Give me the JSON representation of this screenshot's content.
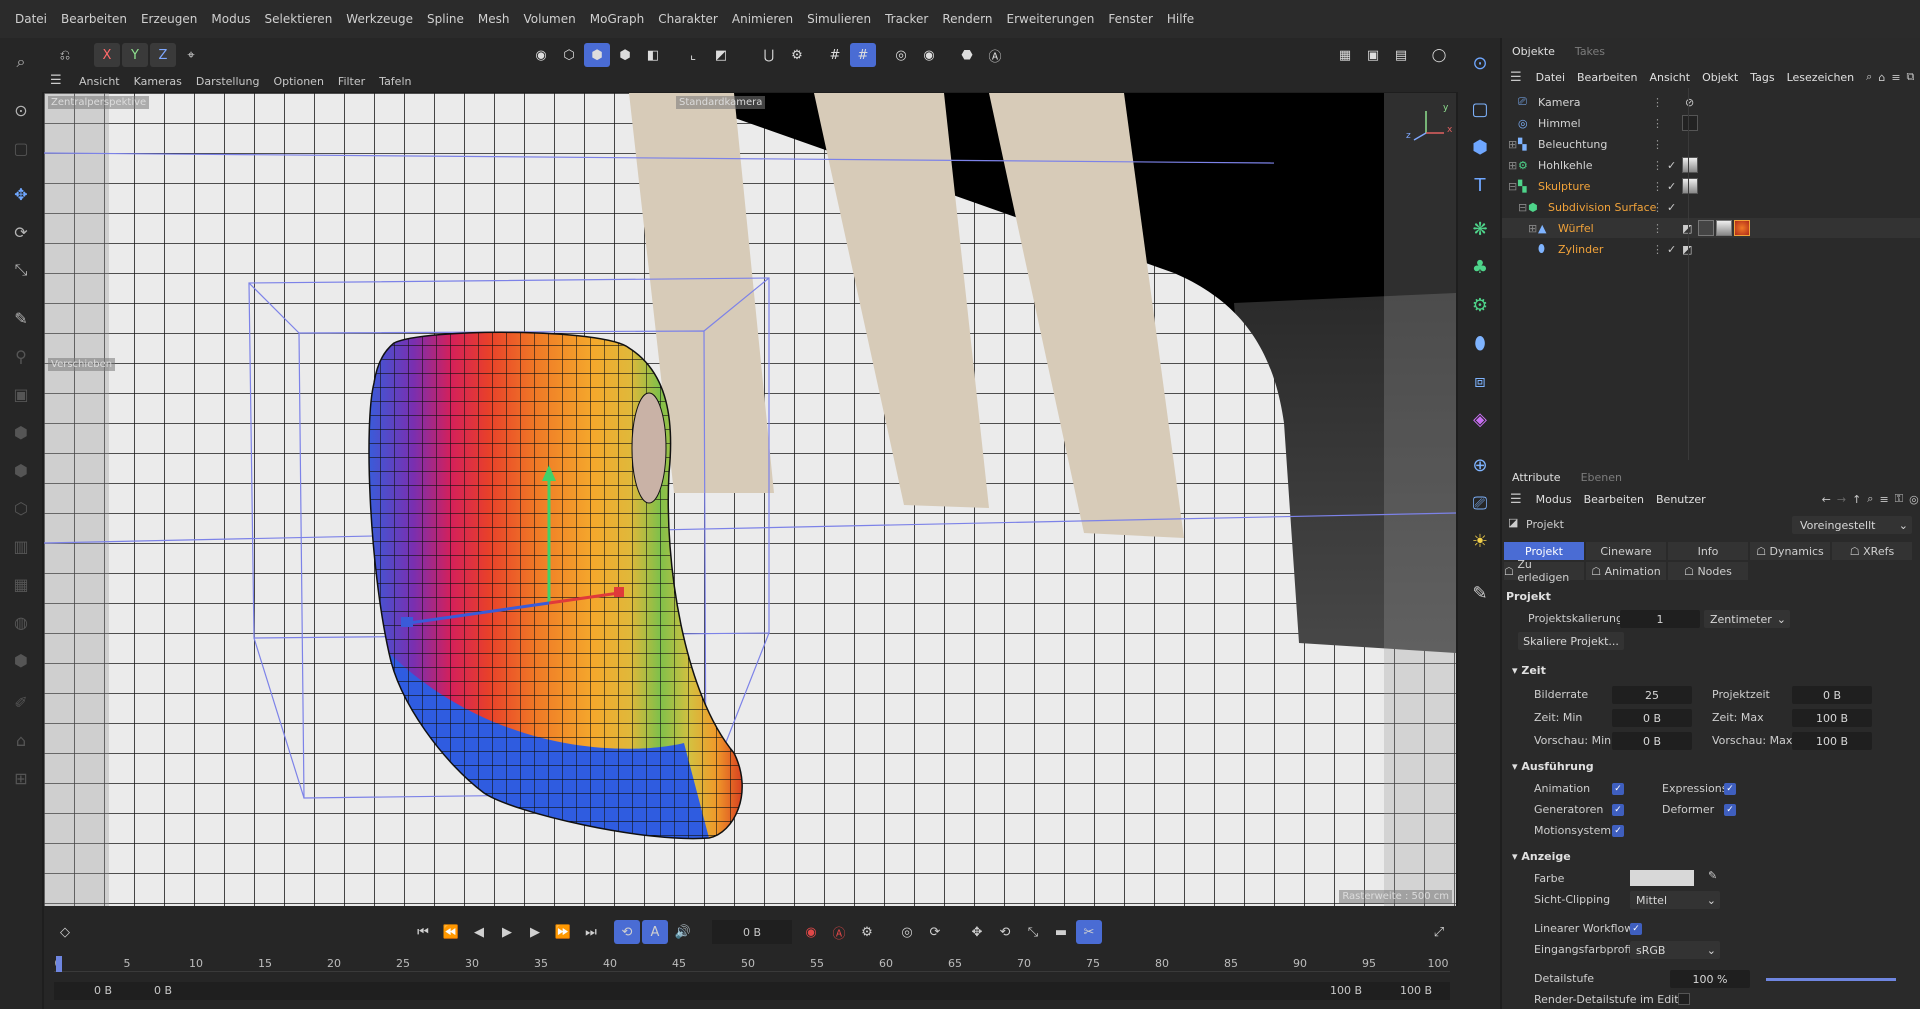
{
  "menubar": [
    "Datei",
    "Bearbeiten",
    "Erzeugen",
    "Modus",
    "Selektieren",
    "Werkzeuge",
    "Spline",
    "Mesh",
    "Volumen",
    "MoGraph",
    "Charakter",
    "Animieren",
    "Simulieren",
    "Tracker",
    "Rendern",
    "Erweiterungen",
    "Fenster",
    "Hilfe"
  ],
  "toolbar": {
    "axis_x": "X",
    "axis_y": "Y",
    "axis_z": "Z"
  },
  "viewmenu": [
    "Ansicht",
    "Kameras",
    "Darstellung",
    "Optionen",
    "Filter",
    "Tafeln"
  ],
  "viewport": {
    "projection_label": "Zentralperspektive",
    "camera_label": "Standardkamera",
    "tool_label": "Verschieben",
    "grid_label": "Rasterweite : 500 cm",
    "axis_x": "x",
    "axis_y": "y",
    "axis_z": "z"
  },
  "objects": {
    "tabs": [
      "Objekte",
      "Takes"
    ],
    "menu": [
      "Datei",
      "Bearbeiten",
      "Ansicht",
      "Objekt",
      "Tags",
      "Lesezeichen"
    ],
    "rows": [
      {
        "name": "Kamera",
        "orange": false
      },
      {
        "name": "Himmel",
        "orange": false
      },
      {
        "name": "Beleuchtung",
        "orange": false
      },
      {
        "name": "Hohlkehle",
        "orange": false
      },
      {
        "name": "Skulpture",
        "orange": true
      },
      {
        "name": "Subdivision Surface",
        "orange": true
      },
      {
        "name": "Würfel",
        "orange": true
      },
      {
        "name": "Zylinder",
        "orange": true
      }
    ]
  },
  "attributes": {
    "tabs": [
      "Attribute",
      "Ebenen"
    ],
    "menu": [
      "Modus",
      "Bearbeiten",
      "Benutzer"
    ],
    "title": "Projekt",
    "preset": "Voreingestellt",
    "subtabs1": [
      "Projekt",
      "Cineware",
      "Info",
      "Dynamics",
      "XRefs"
    ],
    "subtabs2": [
      "Zu erledigen",
      "Animation",
      "Nodes"
    ],
    "section_projekt": "Projekt",
    "projektskalierung_label": "Projektskalierung",
    "projektskalierung_value": "1",
    "projektskalierung_unit": "Zentimeter",
    "skaliere_button": "Skaliere Projekt...",
    "section_zeit": "Zeit",
    "bilderrate_label": "Bilderrate",
    "bilderrate": "25",
    "projektzeit_label": "Projektzeit",
    "projektzeit": "0 B",
    "zeitmin_label": "Zeit: Min",
    "zeitmin": "0 B",
    "zeitmax_label": "Zeit: Max",
    "zeitmax": "100 B",
    "vorschaumin_label": "Vorschau: Min",
    "vorschaumin": "0 B",
    "vorschaumax_label": "Vorschau: Max",
    "vorschaumax": "100 B",
    "section_ausfuehrung": "Ausführung",
    "animation_label": "Animation",
    "expressions_label": "Expressions",
    "generatoren_label": "Generatoren",
    "deformer_label": "Deformer",
    "motionsystem_label": "Motionsystem",
    "section_anzeige": "Anzeige",
    "farbe_label": "Farbe",
    "sichtclipping_label": "Sicht-Clipping",
    "sichtclipping_value": "Mittel",
    "linearer_label": "Linearer Workflow",
    "eingangsfarbprofil_label": "Eingangsfarbprofil",
    "eingangsfarbprofil_value": "sRGB",
    "detailstufe_label": "Detailstufe",
    "detailstufe_value": "100 %",
    "detailstufe_level": 1.0,
    "renderdetail_label": "Render-Detailstufe im Editor"
  },
  "timeline": {
    "current_frame": "0 B",
    "ticks": [
      "0",
      "5",
      "10",
      "15",
      "20",
      "25",
      "30",
      "35",
      "40",
      "45",
      "50",
      "55",
      "60",
      "65",
      "70",
      "75",
      "80",
      "85",
      "90",
      "95",
      "100"
    ],
    "range_start": "0 B",
    "range_start2": "0 B",
    "range_end": "100 B",
    "range_end2": "100 B"
  },
  "colors": {
    "accent": "#4a6cd4",
    "orange": "#f2a33a",
    "panel": "#2a2a2a"
  }
}
